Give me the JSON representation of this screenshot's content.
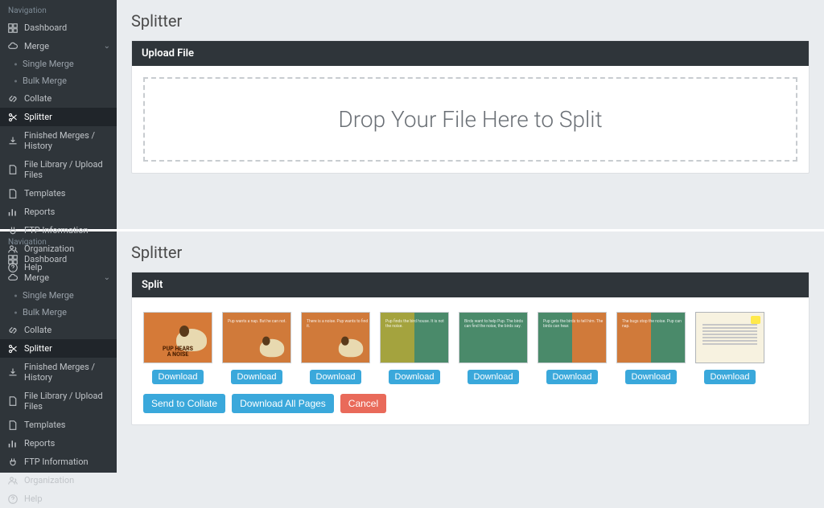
{
  "sidebar": {
    "section_label": "Navigation",
    "items": [
      {
        "id": "dashboard",
        "label": "Dashboard",
        "icon": "grid-icon"
      },
      {
        "id": "merge",
        "label": "Merge",
        "icon": "cloud-icon",
        "expandable": true
      },
      {
        "id": "collate",
        "label": "Collate",
        "icon": "link-icon"
      },
      {
        "id": "splitter",
        "label": "Splitter",
        "icon": "scissors-icon",
        "active": true
      },
      {
        "id": "history",
        "label": "Finished Merges / History",
        "icon": "download-icon"
      },
      {
        "id": "library",
        "label": "File Library / Upload Files",
        "icon": "file-icon"
      },
      {
        "id": "templates",
        "label": "Templates",
        "icon": "file-icon"
      },
      {
        "id": "reports",
        "label": "Reports",
        "icon": "bar-icon"
      },
      {
        "id": "ftp",
        "label": "FTP Information",
        "icon": "plug-icon"
      },
      {
        "id": "org",
        "label": "Organization",
        "icon": "users-icon"
      },
      {
        "id": "help",
        "label": "Help",
        "icon": "question-icon"
      }
    ],
    "merge_subitems": [
      {
        "id": "single-merge",
        "label": "Single Merge"
      },
      {
        "id": "bulk-merge",
        "label": "Bulk Merge"
      }
    ]
  },
  "top_panel": {
    "page_title": "Splitter",
    "card_header": "Upload File",
    "dropzone_text": "Drop Your File Here to Split"
  },
  "bottom_panel": {
    "page_title": "Splitter",
    "card_header": "Split",
    "thumbs": [
      {
        "id": "p1",
        "variant": "cover",
        "cover_line1": "PUP HEARS",
        "cover_line2": "A NOISE",
        "download_label": "Download"
      },
      {
        "id": "p2",
        "variant": "orange",
        "tinytext": "Pup wants a nap.\nBut he can not.",
        "download_label": "Download"
      },
      {
        "id": "p3",
        "variant": "orange",
        "tinytext": "There is a noise.\nPup wants to find it.",
        "download_label": "Download"
      },
      {
        "id": "p4",
        "variant": "split-oliveteal",
        "tinytext": "Pup finds the bird\nhouse.\nIt is not the noise.",
        "download_label": "Download"
      },
      {
        "id": "p5",
        "variant": "teal",
        "tinytext": "Birds want to help\nPup.\nThe birds can find\nthe noise, the birds say.",
        "download_label": "Download"
      },
      {
        "id": "p6",
        "variant": "split-tealorange",
        "tinytext": "Pup gets the birds\nto tell him.\nThe birds can hear.",
        "download_label": "Download"
      },
      {
        "id": "p7",
        "variant": "split-orangeteal",
        "tinytext": "The bugs stop the\nnoise.\nPup can nap.",
        "download_label": "Download"
      },
      {
        "id": "p8",
        "variant": "backcover",
        "download_label": "Download"
      }
    ],
    "actions": {
      "send_collate": "Send to Collate",
      "download_all": "Download All Pages",
      "cancel": "Cancel"
    }
  },
  "colors": {
    "sidebar_bg": "#2f353a",
    "btn_info": "#3aa8db",
    "btn_danger": "#e96a5a"
  }
}
